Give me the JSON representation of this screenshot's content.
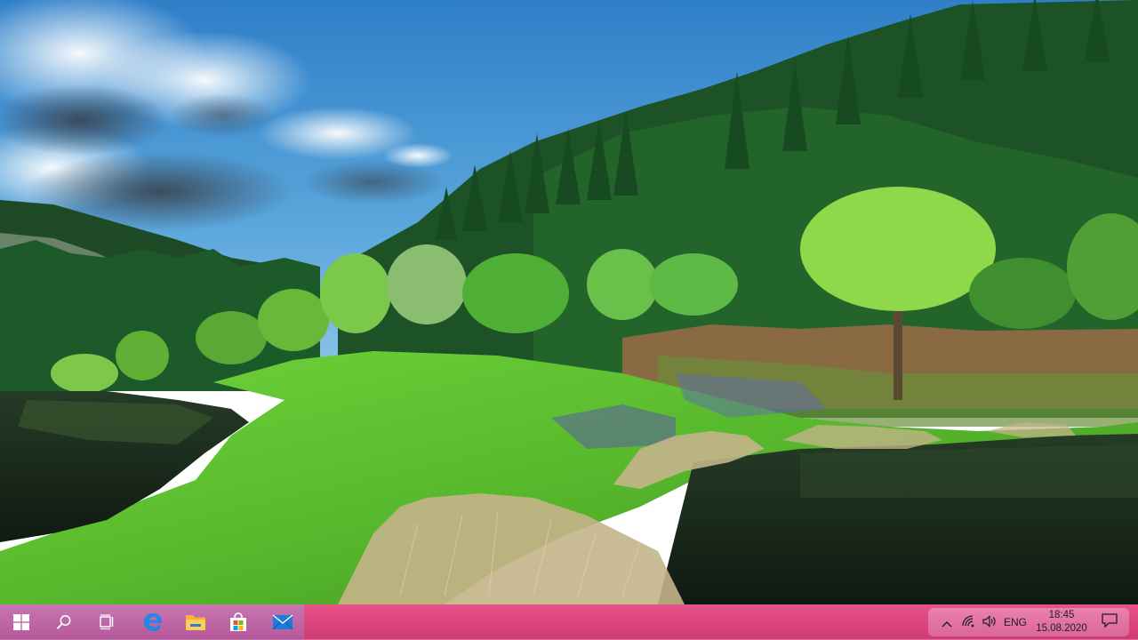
{
  "wallpaper": {
    "scene": "forest-lake-landscape",
    "colors": {
      "sky": "#3f8fd2",
      "forest": "#1e5a2a",
      "meadow": "#5cbf2e",
      "water": "#1c2a1e"
    }
  },
  "taskbar": {
    "color": "#de4780",
    "start": {
      "icon": "windows-logo-icon"
    },
    "search": {
      "icon": "search-icon"
    },
    "task_view": {
      "icon": "task-view-icon"
    },
    "pinned": [
      {
        "name": "Microsoft Edge",
        "icon": "edge-icon"
      },
      {
        "name": "File Explorer",
        "icon": "file-explorer-icon"
      },
      {
        "name": "Microsoft Store",
        "icon": "store-icon"
      },
      {
        "name": "Mail",
        "icon": "mail-icon"
      }
    ],
    "tray": {
      "show_hidden_icon": "chevron-up-icon",
      "network_icon": "wifi-icon",
      "volume_icon": "speaker-icon",
      "language": "ENG",
      "time": "18:45",
      "date": "15.08.2020",
      "action_center_icon": "notification-icon"
    }
  }
}
